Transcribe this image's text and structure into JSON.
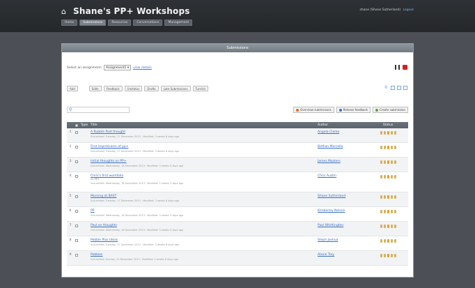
{
  "header": {
    "title": "Shane's PP+ Workshops",
    "user": "shane (Shane Sutherland)",
    "logout": "Logout",
    "tabs": [
      {
        "label": "Home",
        "active": false
      },
      {
        "label": "Submissions",
        "active": true
      },
      {
        "label": "Resources",
        "active": false
      },
      {
        "label": "Conversations",
        "active": false
      },
      {
        "label": "Management",
        "active": false
      }
    ]
  },
  "panel": {
    "title": "Submissions",
    "assign_label": "Select an assignment:",
    "assign_value": "Assignment1",
    "view_details": "view details",
    "filters": [
      "Add",
      "Edits",
      "Feedback",
      "Unstatus",
      "Drafts",
      "Late Submissions",
      "Turnitin"
    ],
    "actions": [
      {
        "label": "Overview submissions",
        "color": "#e06a1b"
      },
      {
        "label": "Release feedback",
        "color": "#3a6fc2"
      },
      {
        "label": "Create submission",
        "color": "#5b9d3a"
      }
    ],
    "columns": {
      "type": "Type",
      "title": "Title",
      "author": "Author",
      "status": "Status"
    },
    "rows": [
      {
        "n": "1",
        "title": "A Rubble Post thought",
        "sub": "Sub-mitted: Tuesday, 17 December 2013 · Modified: 3 weeks 6 days ago",
        "author": "Angela Clarke"
      },
      {
        "n": "2",
        "title": "First impressions of pp+",
        "sub": "Sub-mitted: Tuesday, 17 December 2013 · Modified: 3 weeks 6 days ago",
        "author": "Bethan Mercelle"
      },
      {
        "n": "3",
        "title": "Initial thoughts on PP+",
        "sub": "Sub-mitted: Wednesday, 18 December 2013 · Modified: 3 weeks 5 days ago",
        "author": "James Masters"
      },
      {
        "n": "4",
        "title": "Chris's first workfolio",
        "sub": "Sub-mitted: Wednesday, 18 December 2013 · Modified: 2 weeks 3 days ago",
        "extra": "re: PP+",
        "author": "Chris Austin"
      },
      {
        "n": "5",
        "title": "Morning at BAST",
        "sub": "Sub-mitted: Tuesday, 17 December 2013 · Modified: 3 weeks 6 days ago",
        "author": "Shane Sutherland"
      },
      {
        "n": "6",
        "title": "PP",
        "sub": "Sub-mitted: Wednesday, 18 December 2013 · Modified: 3 weeks 5 days ago",
        "author": "Kimberley Nelson"
      },
      {
        "n": "7",
        "title": "Paul on thoughts",
        "sub": "Sub-mitted: Wednesday, 18 December 2013 · Modified: 3 weeks 5 days ago",
        "author": "Paul Whittington"
      },
      {
        "n": "8",
        "title": "Pebble Plus Ideas",
        "sub": "Sub-mitted: Tuesday, 17 December 2013 · Modified: 3 weeks 6 days ago",
        "author": "Steph Joshua"
      },
      {
        "n": "9",
        "title": "Pebbles",
        "sub": "Sub-mitted: Sunday, 22 December 2013 · Modified: 2 weeks 6 days ago",
        "author": "Alexis Troy"
      }
    ]
  }
}
